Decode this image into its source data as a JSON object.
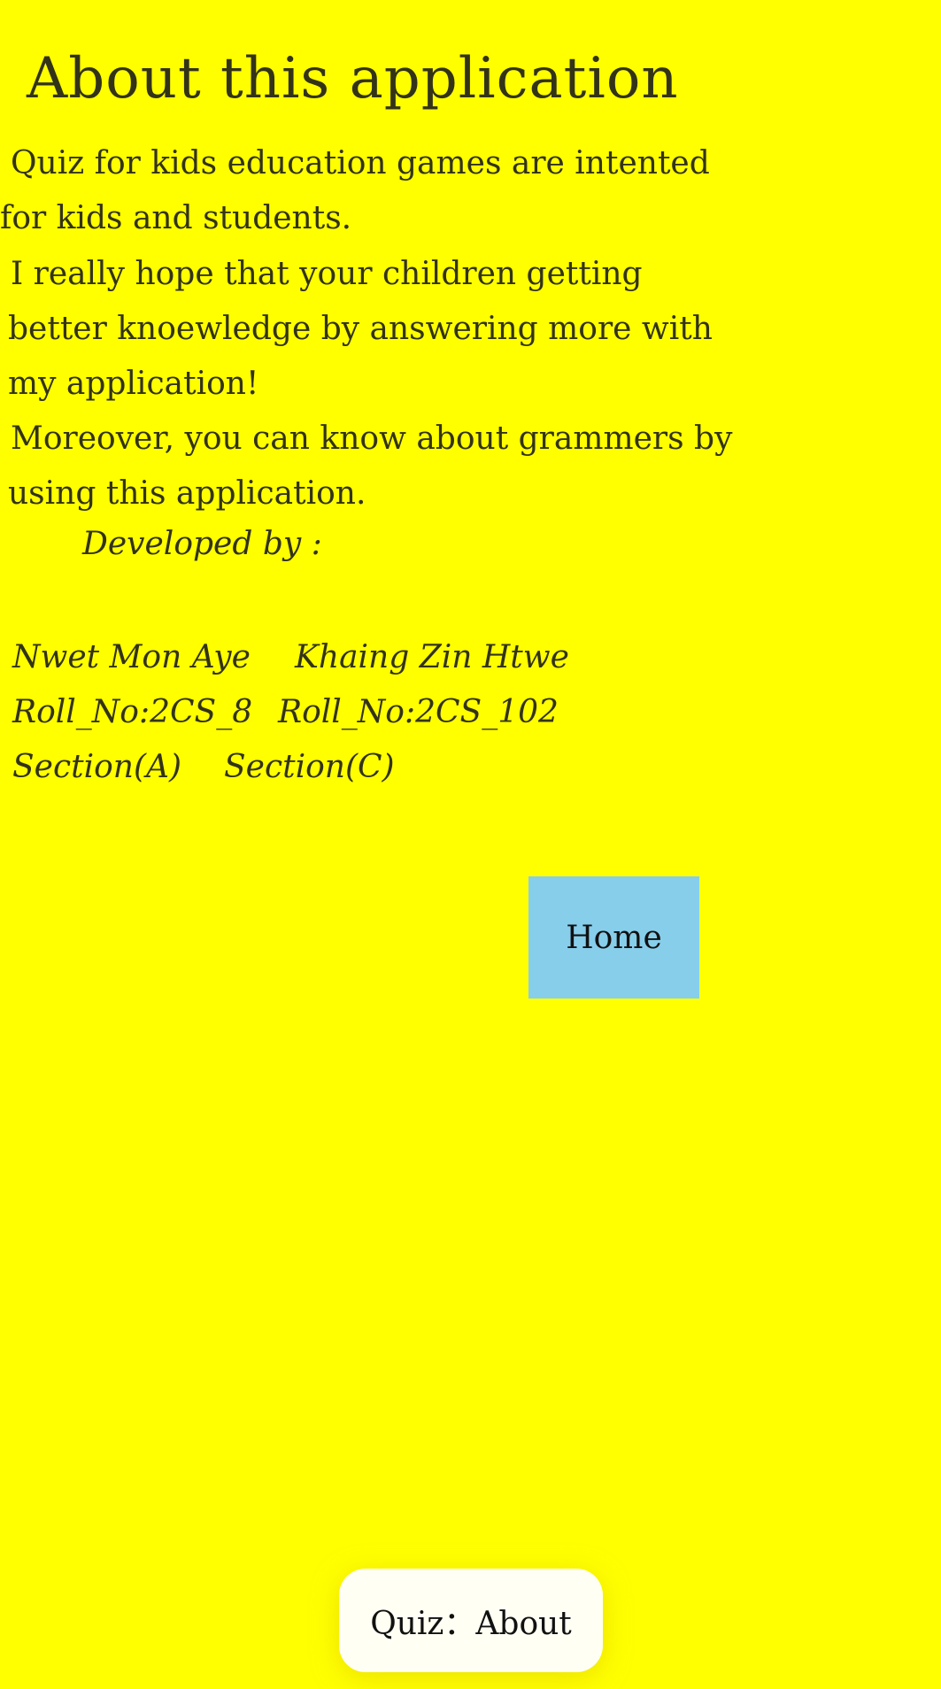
{
  "page": {
    "title": "About this application",
    "background_color": "#ffff00"
  },
  "description": {
    "paragraph1": [
      "Quiz for kids education games are intented",
      "for kids and students."
    ],
    "paragraph2": [
      "I really hope that your children getting",
      "better knoewledge by answering more with",
      "my application!"
    ],
    "paragraph3": [
      "Moreover, you can know about grammers by",
      "using this application."
    ]
  },
  "credits": {
    "label": "Developed by :",
    "developers": [
      {
        "name": "Nwet Mon Aye",
        "roll": "Roll_No:2CS_8",
        "section": "Section(A)"
      },
      {
        "name": "Khaing Zin Htwe",
        "roll": "Roll_No:2CS_102",
        "section": "Section(C)"
      }
    ]
  },
  "home_button": {
    "label": "Home",
    "color": "#87ceeb"
  },
  "toast": {
    "text": "Quiz：About"
  }
}
